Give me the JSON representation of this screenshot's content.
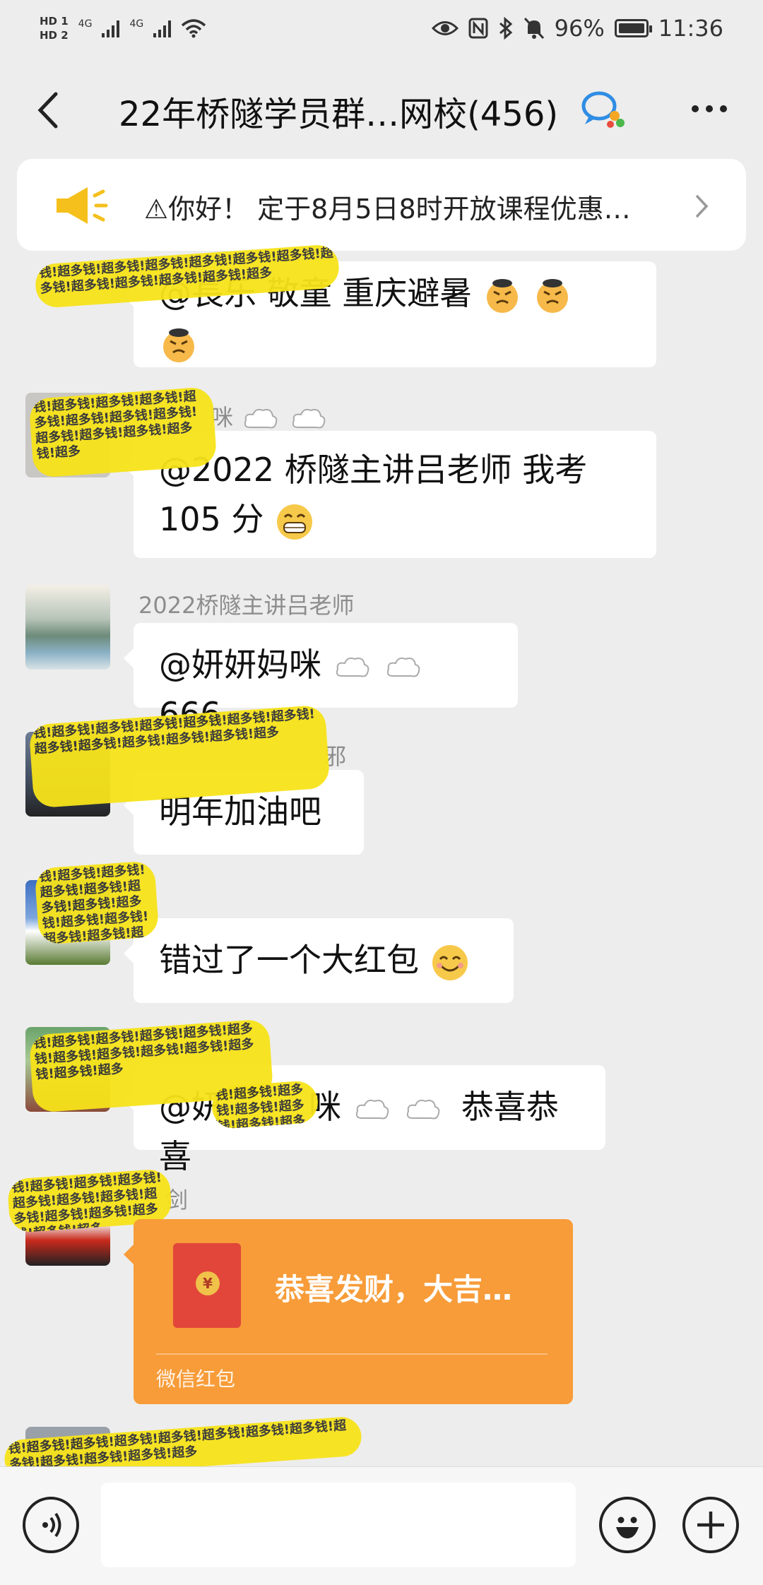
{
  "status_bar": {
    "hd1": "HD 1",
    "hd2": "HD 2",
    "net1": "4G",
    "net2": "4G",
    "battery": "96%",
    "time": "11:36",
    "icons": [
      "eye-icon",
      "nfc-icon",
      "bluetooth-icon",
      "mute-icon",
      "battery-icon"
    ]
  },
  "header": {
    "title": "22年桥隧学员群…网校(456)",
    "icons": [
      "back-icon",
      "group-chat-icon",
      "more-icon"
    ]
  },
  "announcement": {
    "text": "⚠你好！ 定于8月5日8时开放课程优惠…",
    "icons": [
      "megaphone-icon",
      "chevron-right-icon"
    ]
  },
  "messages": [
    {
      "id": "m0",
      "text": "@長乐 敬童  重庆避暑"
    },
    {
      "id": "m1",
      "sender": "咪",
      "text": "@2022 桥隧主讲吕老师  我考",
      "text2": "105 分"
    },
    {
      "id": "m2",
      "sender": "2022桥隧主讲吕老师",
      "text_a": "@妍妍妈咪",
      "text_b": "666"
    },
    {
      "id": "m3",
      "sender": "邪",
      "text": "明年加油吧"
    },
    {
      "id": "m4",
      "text": "错过了一个大红包"
    },
    {
      "id": "m5",
      "text_a": "@妍",
      "text_b": "咪",
      "text_c": "恭喜恭喜"
    },
    {
      "id": "m6",
      "sender": "剑",
      "packet_title": "恭喜发财，大吉…",
      "packet_label": "微信红包",
      "coin": "¥"
    }
  ],
  "redaction_text": "钱!超多钱!超多钱!超多钱!超多钱!超多钱!超多钱!超多钱!超多钱!超多钱!超多钱!超多钱!超多",
  "input_bar": {
    "placeholder": "",
    "icons": [
      "voice-icon",
      "emoji-icon",
      "plus-icon"
    ]
  },
  "colors": {
    "background": "#ededed",
    "bubble": "#ffffff",
    "red_packet": "#f79c39",
    "redaction": "#f7e31a"
  }
}
